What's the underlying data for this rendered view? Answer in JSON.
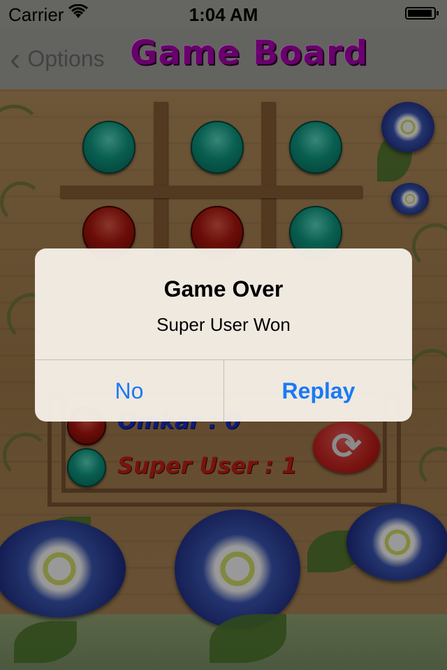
{
  "status_bar": {
    "carrier": "Carrier",
    "time": "1:04 AM",
    "wifi_icon": "wifi-icon",
    "battery_icon": "battery-icon",
    "battery_level": 0.95
  },
  "nav": {
    "back_label": "Options",
    "title": "Game Board"
  },
  "board": {
    "rows": [
      [
        "teal",
        "teal",
        "teal"
      ],
      [
        "red",
        "red",
        "teal"
      ],
      [
        "",
        "",
        ""
      ]
    ]
  },
  "scores": {
    "player1": "Omkar : 0",
    "player2": "Super User : 1",
    "player1_color": "#1a2ecc",
    "player2_color": "#c82018",
    "reset_icon": "refresh-icon"
  },
  "alert": {
    "title": "Game Over",
    "message": "Super User Won",
    "no_label": "No",
    "replay_label": "Replay",
    "button_color": "#1a7af5"
  },
  "colors": {
    "title_magenta": "#b000b6",
    "teal_piece": "#0f9e86",
    "red_piece": "#b3170f",
    "wood": "#b08a5a"
  }
}
